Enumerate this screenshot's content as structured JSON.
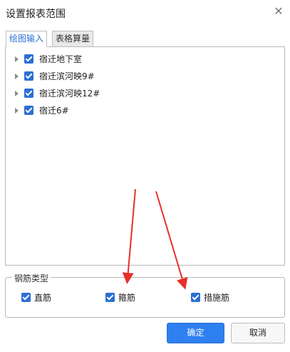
{
  "dialog": {
    "title": "设置报表范围",
    "close_icon": "close-icon"
  },
  "tabs": [
    {
      "label": "绘图输入",
      "active": true
    },
    {
      "label": "表格算量",
      "active": false
    }
  ],
  "tree": {
    "items": [
      {
        "label": "宿迁地下室",
        "checked": true
      },
      {
        "label": "宿迁滨河映9#",
        "checked": true
      },
      {
        "label": "宿迁滨河映12#",
        "checked": true
      },
      {
        "label": "宿迁6#",
        "checked": true
      }
    ]
  },
  "rebar_type": {
    "legend": "钢筋类型",
    "options": [
      {
        "label": "直筋",
        "checked": true
      },
      {
        "label": "箍筋",
        "checked": true
      },
      {
        "label": "措施筋",
        "checked": true
      }
    ]
  },
  "buttons": {
    "ok": "确定",
    "cancel": "取消"
  },
  "colors": {
    "accent": "#2e7ff0",
    "checkbox": "#2b6fd4",
    "annotation_arrow": "#e8302b",
    "active_tab_text": "#2a6fd6"
  }
}
